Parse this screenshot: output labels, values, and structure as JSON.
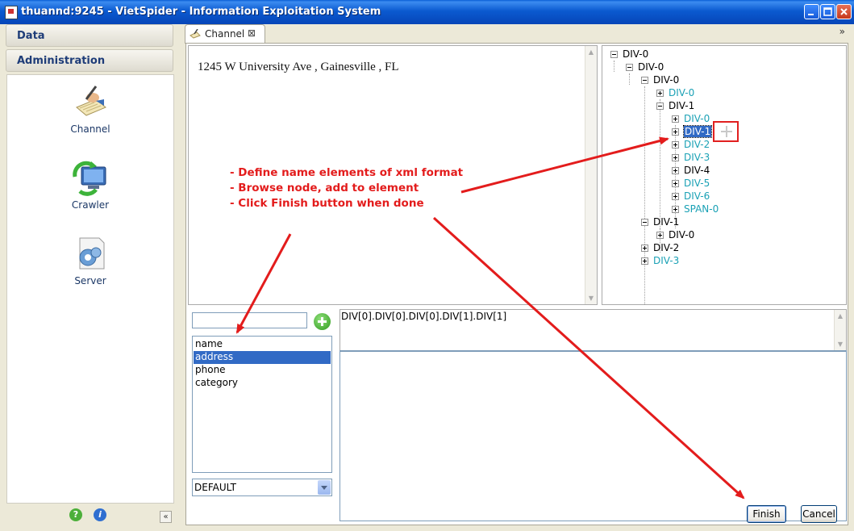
{
  "window": {
    "title": "thuannd:9245 - VietSpider - Information Exploitation System"
  },
  "sidebar": {
    "sections": [
      {
        "label": "Data"
      },
      {
        "label": "Administration"
      }
    ],
    "launchers": [
      {
        "label": "Channel",
        "icon": "channel-icon"
      },
      {
        "label": "Crawler",
        "icon": "crawler-icon"
      },
      {
        "label": "Server",
        "icon": "server-icon"
      }
    ],
    "footer": {
      "help_icon": "?",
      "info_icon": "i",
      "collapse": "«"
    }
  },
  "tabs": [
    {
      "label": "Channel",
      "close": "⊠"
    }
  ],
  "view_menu": "»",
  "preview": {
    "text": "1245 W University Ave , Gainesville , FL"
  },
  "tree": [
    {
      "label": "DIV-0",
      "depth": 0,
      "expanded": true,
      "color": "black"
    },
    {
      "label": "DIV-0",
      "depth": 1,
      "expanded": true,
      "color": "black"
    },
    {
      "label": "DIV-0",
      "depth": 2,
      "expanded": true,
      "color": "black"
    },
    {
      "label": "DIV-0",
      "depth": 3,
      "expanded": false,
      "color": "cyan"
    },
    {
      "label": "DIV-1",
      "depth": 3,
      "expanded": true,
      "color": "black"
    },
    {
      "label": "DIV-0",
      "depth": 4,
      "expanded": false,
      "color": "cyan"
    },
    {
      "label": "DIV-1",
      "depth": 4,
      "expanded": false,
      "color": "black",
      "selected": true
    },
    {
      "label": "DIV-2",
      "depth": 4,
      "expanded": false,
      "color": "cyan"
    },
    {
      "label": "DIV-3",
      "depth": 4,
      "expanded": false,
      "color": "cyan"
    },
    {
      "label": "DIV-4",
      "depth": 4,
      "expanded": false,
      "color": "black"
    },
    {
      "label": "DIV-5",
      "depth": 4,
      "expanded": false,
      "color": "cyan"
    },
    {
      "label": "DIV-6",
      "depth": 4,
      "expanded": false,
      "color": "cyan"
    },
    {
      "label": "SPAN-0",
      "depth": 4,
      "expanded": false,
      "color": "cyan"
    },
    {
      "label": "DIV-1",
      "depth": 2,
      "expanded": true,
      "color": "black"
    },
    {
      "label": "DIV-0",
      "depth": 3,
      "expanded": false,
      "color": "black"
    },
    {
      "label": "DIV-2",
      "depth": 2,
      "expanded": false,
      "color": "black"
    },
    {
      "label": "DIV-3",
      "depth": 2,
      "expanded": false,
      "color": "cyan"
    }
  ],
  "elements": {
    "input_value": "",
    "items": [
      {
        "label": "name",
        "selected": false
      },
      {
        "label": "address",
        "selected": true
      },
      {
        "label": "phone",
        "selected": false
      },
      {
        "label": "category",
        "selected": false
      }
    ],
    "group": "DEFAULT"
  },
  "node_path": "DIV[0].DIV[0].DIV[0].DIV[1].DIV[1]",
  "buttons": {
    "finish": "Finish",
    "cancel": "Cancel"
  },
  "annotation": {
    "lines": [
      "- Define name elements of xml format",
      "- Browse node, add to element",
      "- Click Finish button when done"
    ]
  },
  "colors": {
    "titlebar": "#0b5ad0",
    "selection": "#316ac5",
    "tree_cyan": "#1aa1b5",
    "annotation_red": "#e31c1c"
  }
}
